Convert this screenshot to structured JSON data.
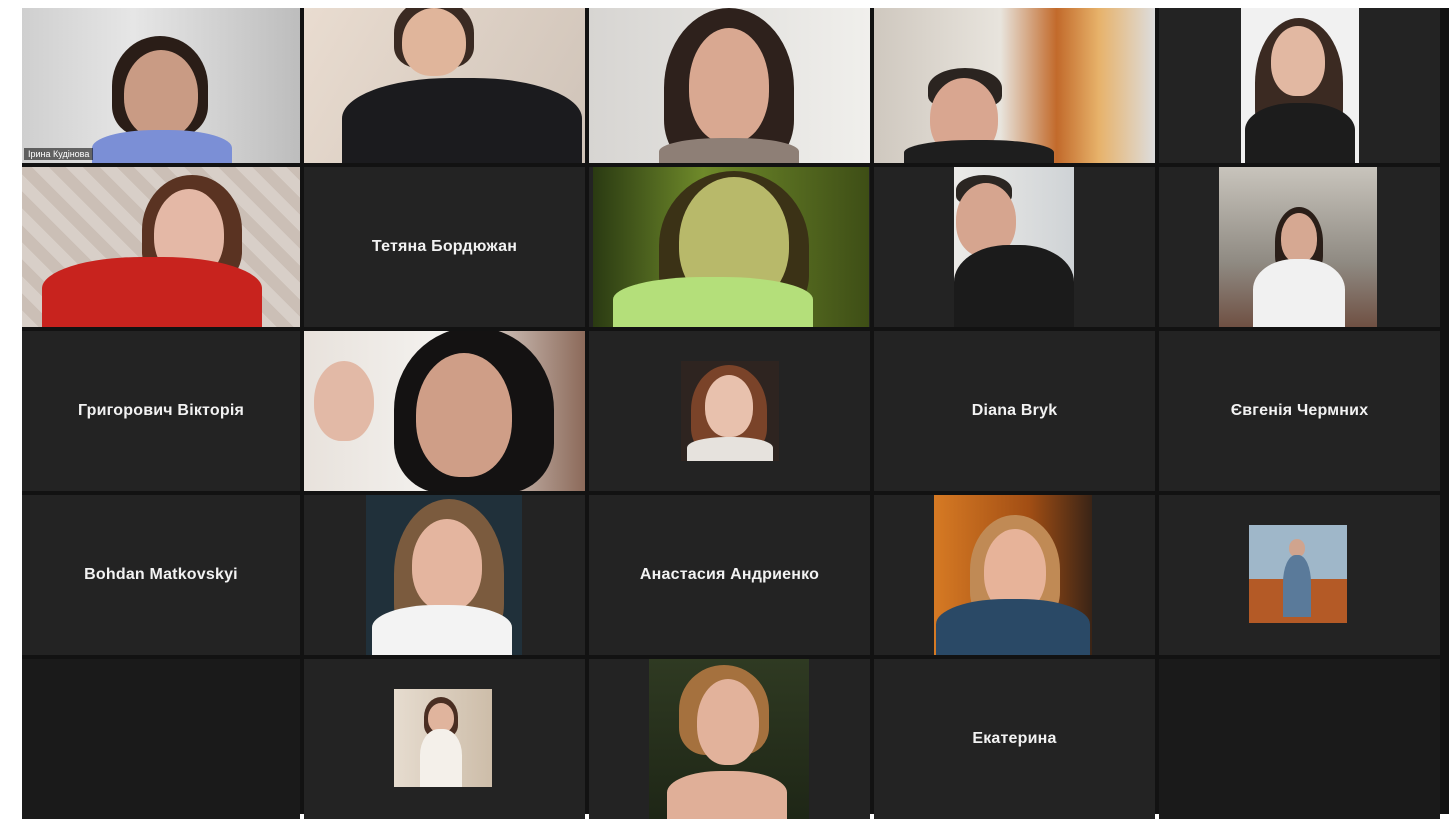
{
  "meeting": {
    "participants": [
      {
        "name": "Ірина Кудінова",
        "video": true,
        "active": true
      },
      {
        "name": "",
        "video": true
      },
      {
        "name": "",
        "video": true
      },
      {
        "name": "",
        "video": true
      },
      {
        "name": "",
        "video": true
      },
      {
        "name": "",
        "video": true
      },
      {
        "name": "Тетяна Бордюжан",
        "video": false
      },
      {
        "name": "",
        "video": true
      },
      {
        "name": "",
        "video": true
      },
      {
        "name": "",
        "video": true
      },
      {
        "name": "Григорович Вікторія",
        "video": false
      },
      {
        "name": "",
        "video": true
      },
      {
        "name": "",
        "video": false,
        "photo": true
      },
      {
        "name": "Diana Bryk",
        "video": false
      },
      {
        "name": "Євгенія Чермних",
        "video": false
      },
      {
        "name": "Bohdan Matkovskyi",
        "video": false
      },
      {
        "name": "",
        "video": true
      },
      {
        "name": "Анастасия Андриенко",
        "video": false
      },
      {
        "name": "",
        "video": true
      },
      {
        "name": "",
        "video": false,
        "photo": true
      },
      {
        "name": "",
        "empty": true
      },
      {
        "name": "",
        "video": false,
        "photo": true
      },
      {
        "name": "",
        "video": true
      },
      {
        "name": "Екатерина",
        "video": false
      },
      {
        "name": "",
        "empty": true
      }
    ]
  },
  "colors": {
    "background": "#121212",
    "tile": "#232323",
    "active_border": "#7dbf4a",
    "name_text": "#f2f2f2"
  }
}
